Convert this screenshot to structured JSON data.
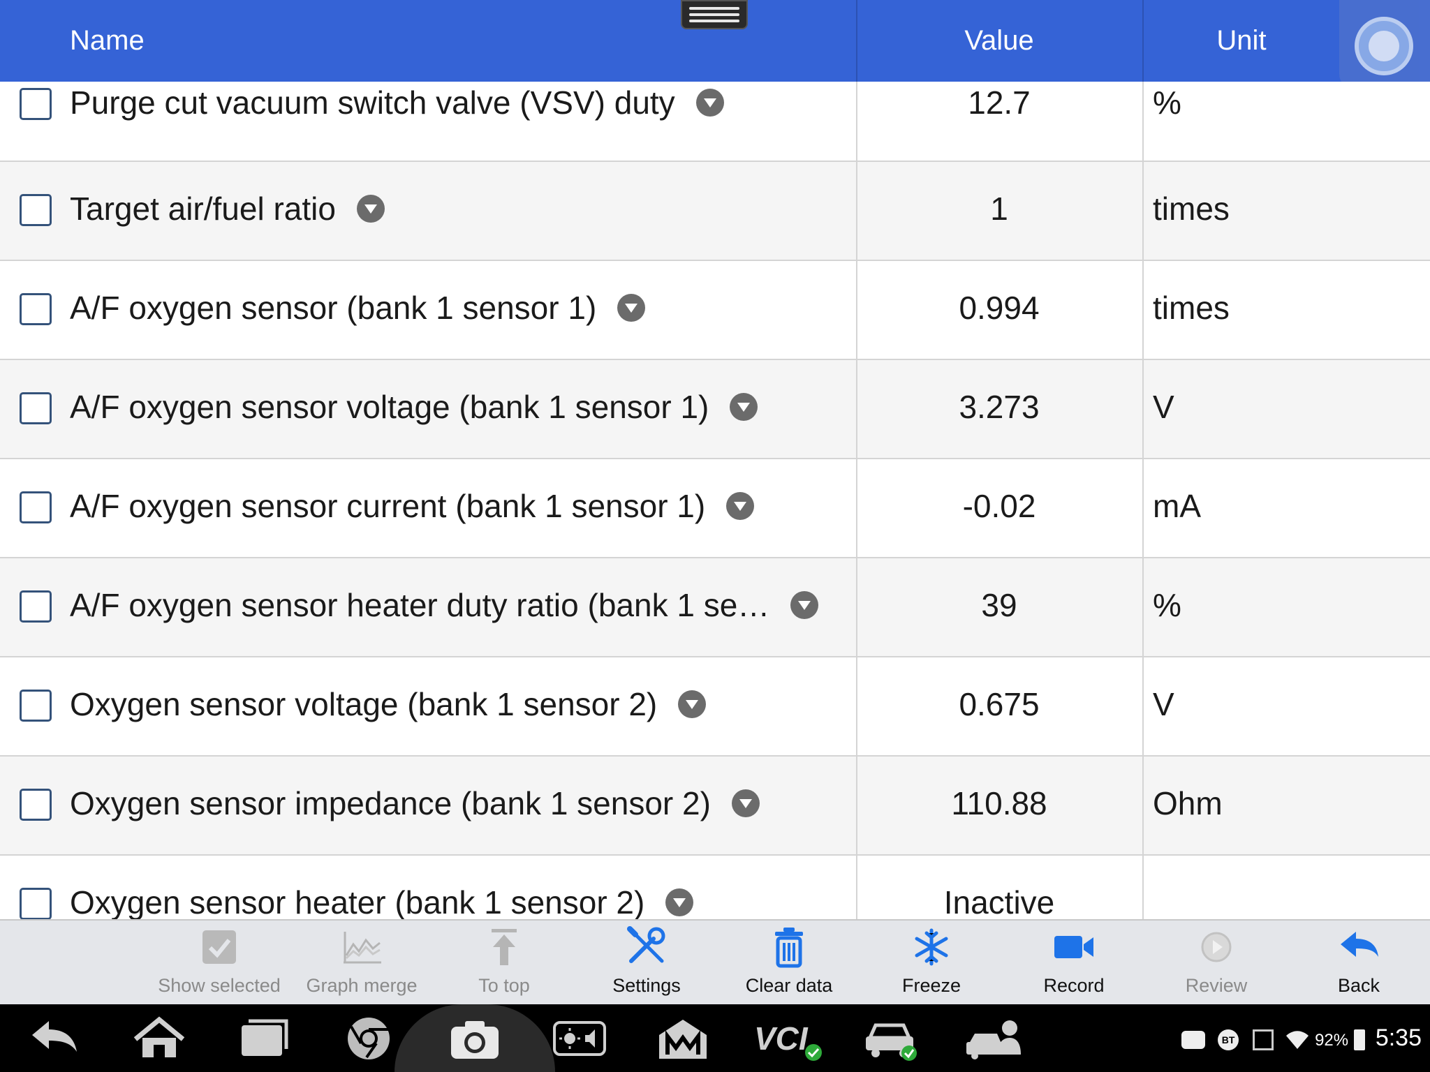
{
  "header": {
    "name": "Name",
    "value": "Value",
    "unit": "Unit"
  },
  "rows": [
    {
      "name": "Purge cut vacuum switch valve (VSV) duty",
      "value": "12.7",
      "unit": "%"
    },
    {
      "name": "Target air/fuel ratio",
      "value": "1",
      "unit": "times"
    },
    {
      "name": "A/F oxygen sensor (bank 1 sensor 1)",
      "value": "0.994",
      "unit": "times"
    },
    {
      "name": "A/F oxygen sensor voltage (bank 1 sensor 1)",
      "value": "3.273",
      "unit": "V"
    },
    {
      "name": "A/F oxygen sensor current (bank 1 sensor 1)",
      "value": "-0.02",
      "unit": "mA"
    },
    {
      "name": "A/F oxygen sensor heater duty ratio (bank 1 se…",
      "value": "39",
      "unit": "%"
    },
    {
      "name": "Oxygen sensor voltage (bank 1 sensor 2)",
      "value": "0.675",
      "unit": "V"
    },
    {
      "name": "Oxygen sensor impedance (bank 1 sensor 2)",
      "value": "110.88",
      "unit": "Ohm"
    },
    {
      "name": "Oxygen sensor heater (bank 1 sensor 2)",
      "value": "Inactive",
      "unit": ""
    }
  ],
  "toolbar": {
    "show_selected": "Show selected",
    "graph_merge": "Graph merge",
    "to_top": "To top",
    "settings": "Settings",
    "clear_data": "Clear data",
    "freeze": "Freeze",
    "record": "Record",
    "review": "Review",
    "back": "Back"
  },
  "status": {
    "bt": "BT",
    "battery": "92%",
    "time": "5:35"
  },
  "navbar": {
    "vci_label": "VCI"
  },
  "colors": {
    "header": "#3563d6",
    "accent": "#1e73e8",
    "disabled": "#9a9a9a"
  }
}
